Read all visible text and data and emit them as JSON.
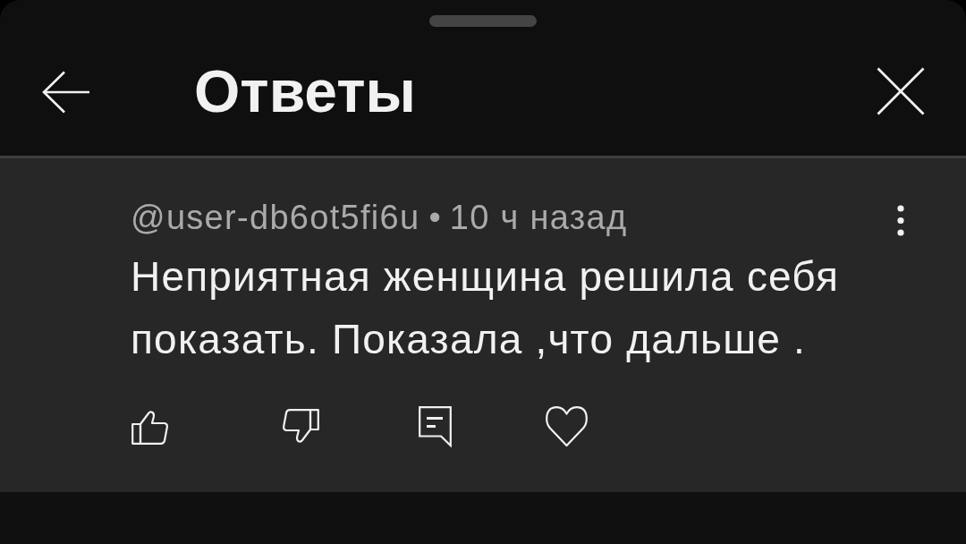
{
  "header": {
    "title": "Ответы"
  },
  "comment": {
    "author": "@user-db6ot5fi6u",
    "separator": "•",
    "time": "10 ч назад",
    "text": "Неприятная женщина решила себя показать. Показала ,что дальше ."
  }
}
